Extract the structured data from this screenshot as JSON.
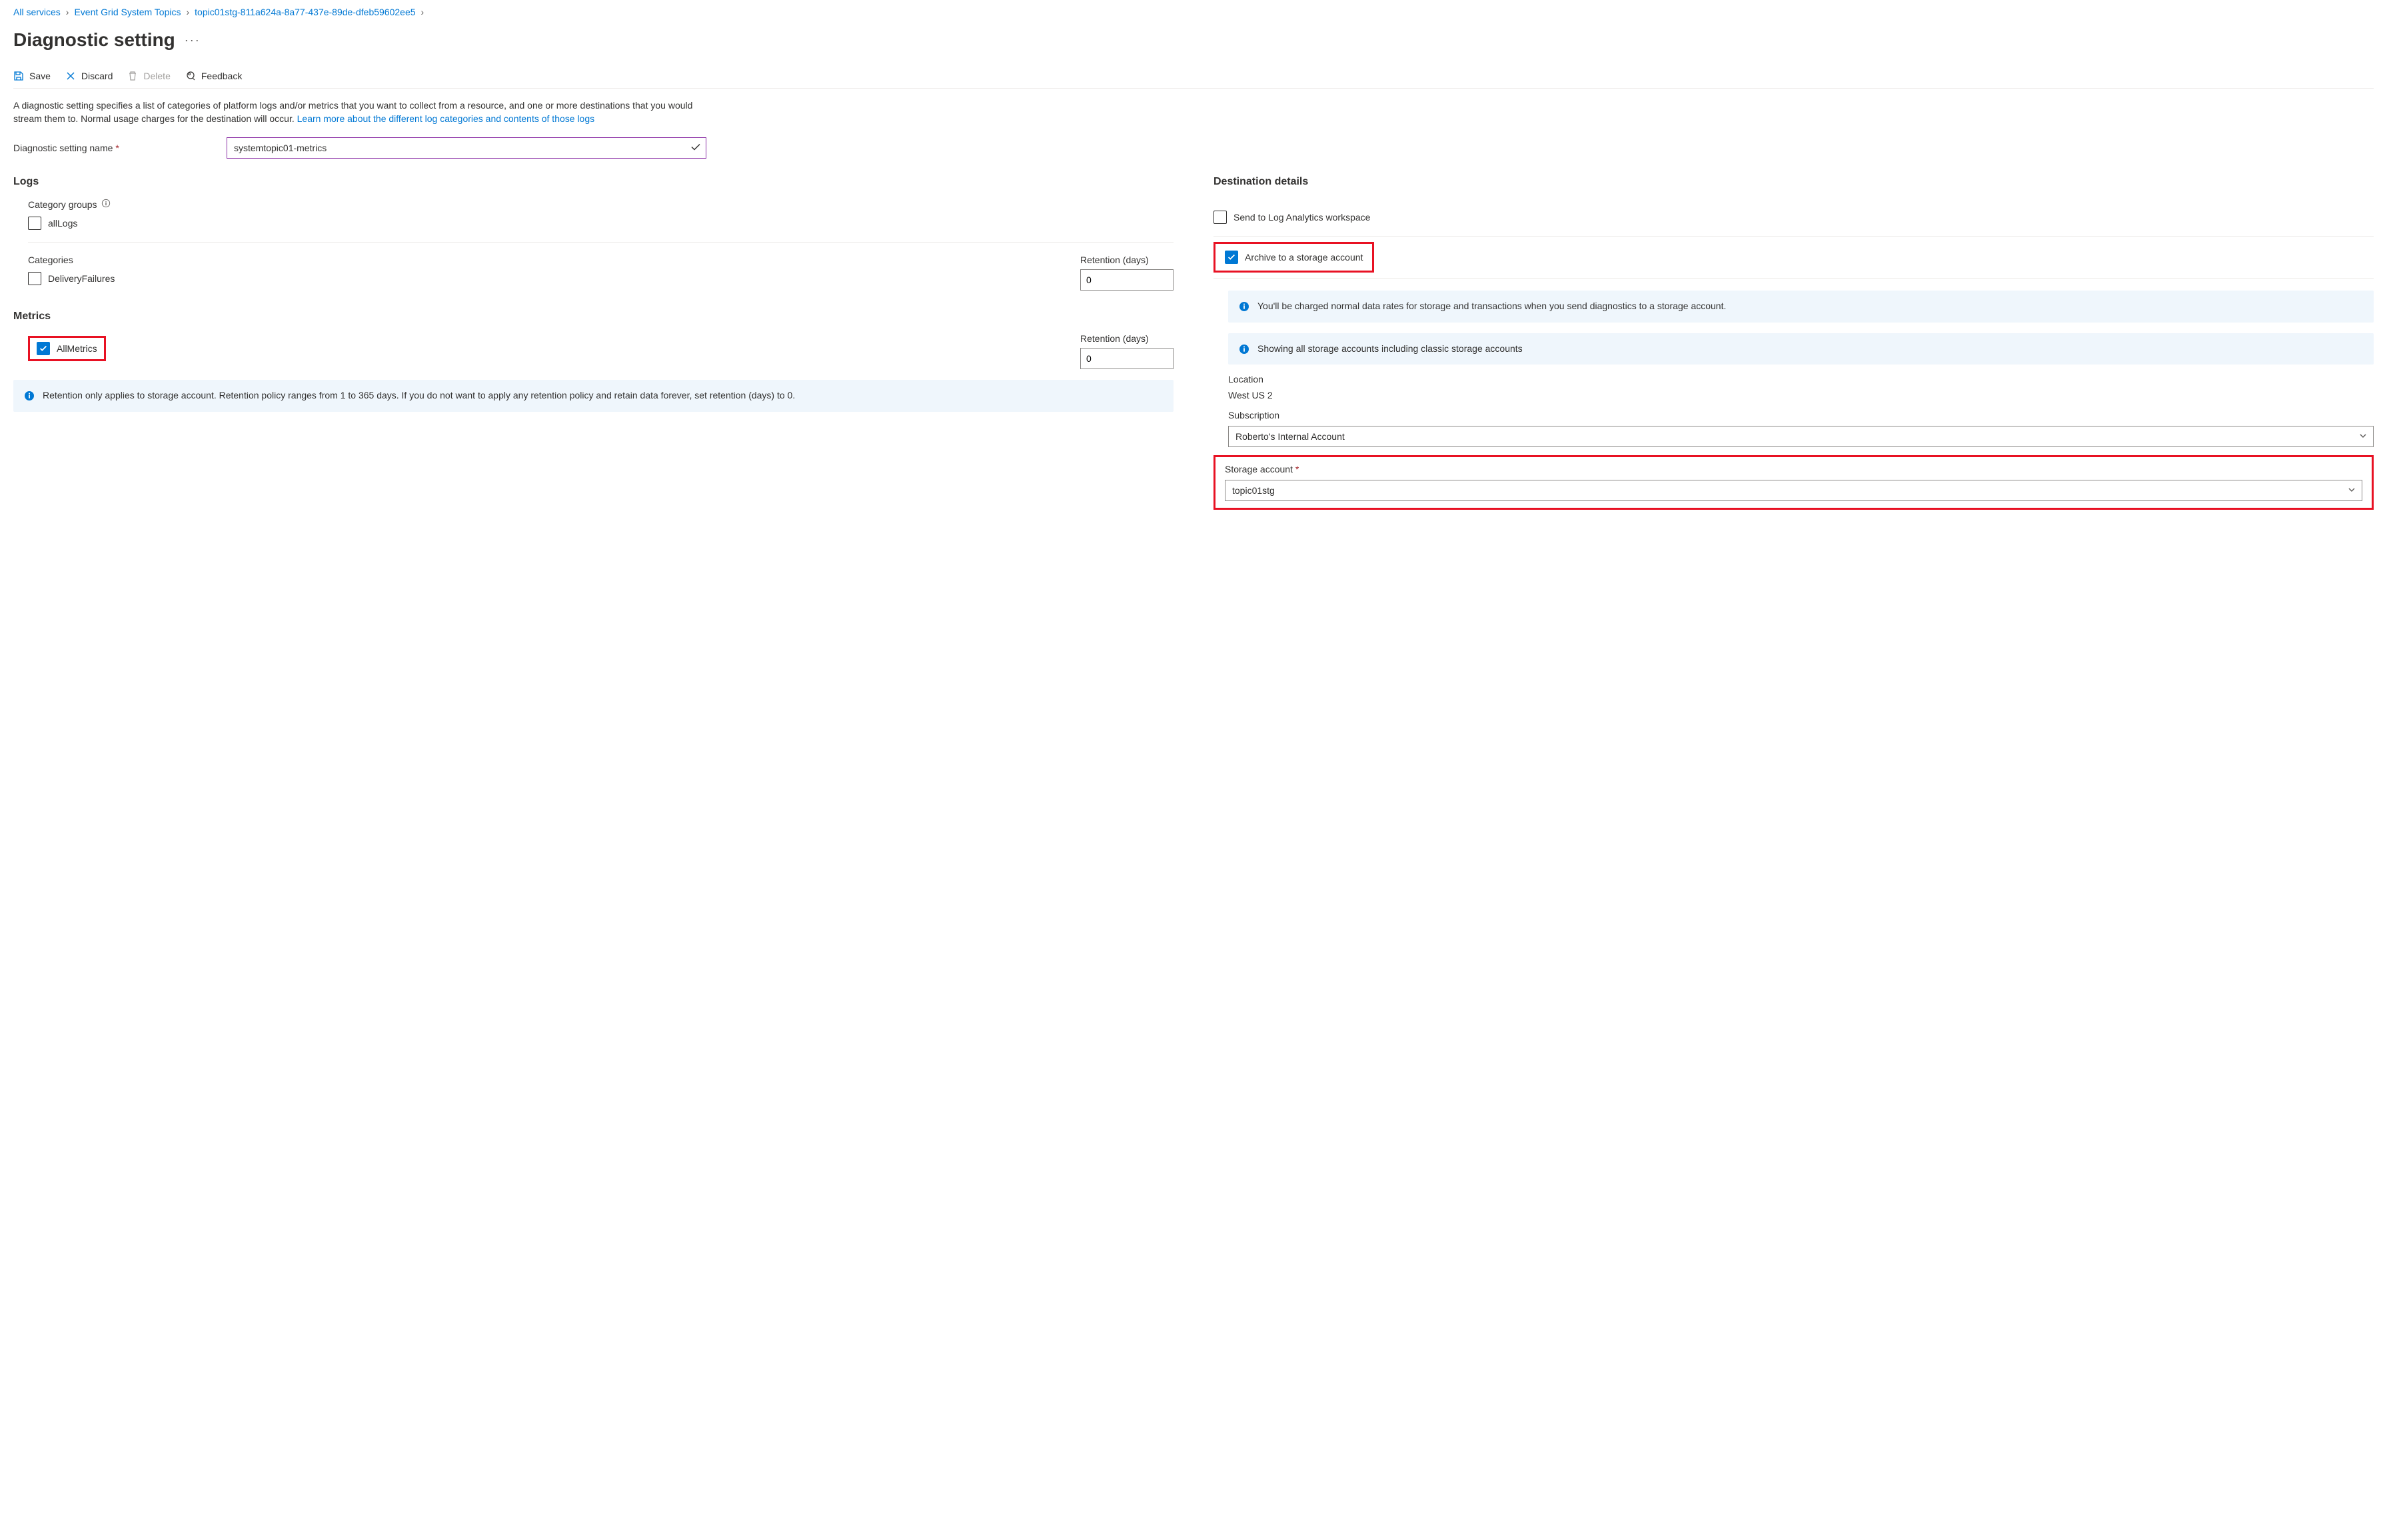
{
  "breadcrumb": {
    "items": [
      "All services",
      "Event Grid System Topics",
      "topic01stg-811a624a-8a77-437e-89de-dfeb59602ee5"
    ]
  },
  "page": {
    "title": "Diagnostic setting"
  },
  "toolbar": {
    "save": "Save",
    "discard": "Discard",
    "delete": "Delete",
    "feedback": "Feedback"
  },
  "description": {
    "text": "A diagnostic setting specifies a list of categories of platform logs and/or metrics that you want to collect from a resource, and one or more destinations that you would stream them to. Normal usage charges for the destination will occur. ",
    "link": "Learn more about the different log categories and contents of those logs"
  },
  "name_field": {
    "label": "Diagnostic setting name",
    "value": "systemtopic01-metrics"
  },
  "logs": {
    "title": "Logs",
    "category_groups_label": "Category groups",
    "allLogs": "allLogs",
    "categories_label": "Categories",
    "deliveryFailures": "DeliveryFailures",
    "retention_label": "Retention (days)",
    "retention_value": "0"
  },
  "metrics": {
    "title": "Metrics",
    "allMetrics": "AllMetrics",
    "retention_label": "Retention (days)",
    "retention_value": "0"
  },
  "retention_info": "Retention only applies to storage account. Retention policy ranges from 1 to 365 days. If you do not want to apply any retention policy and retain data forever, set retention (days) to 0.",
  "dest": {
    "title": "Destination details",
    "log_analytics": "Send to Log Analytics workspace",
    "archive_storage": "Archive to a storage account",
    "charge_info": "You'll be charged normal data rates for storage and transactions when you send diagnostics to a storage account.",
    "classic_info": "Showing all storage accounts including classic storage accounts",
    "location_label": "Location",
    "location_value": "West US 2",
    "subscription_label": "Subscription",
    "subscription_value": "Roberto's Internal Account",
    "storage_label": "Storage account",
    "storage_value": "topic01stg"
  }
}
